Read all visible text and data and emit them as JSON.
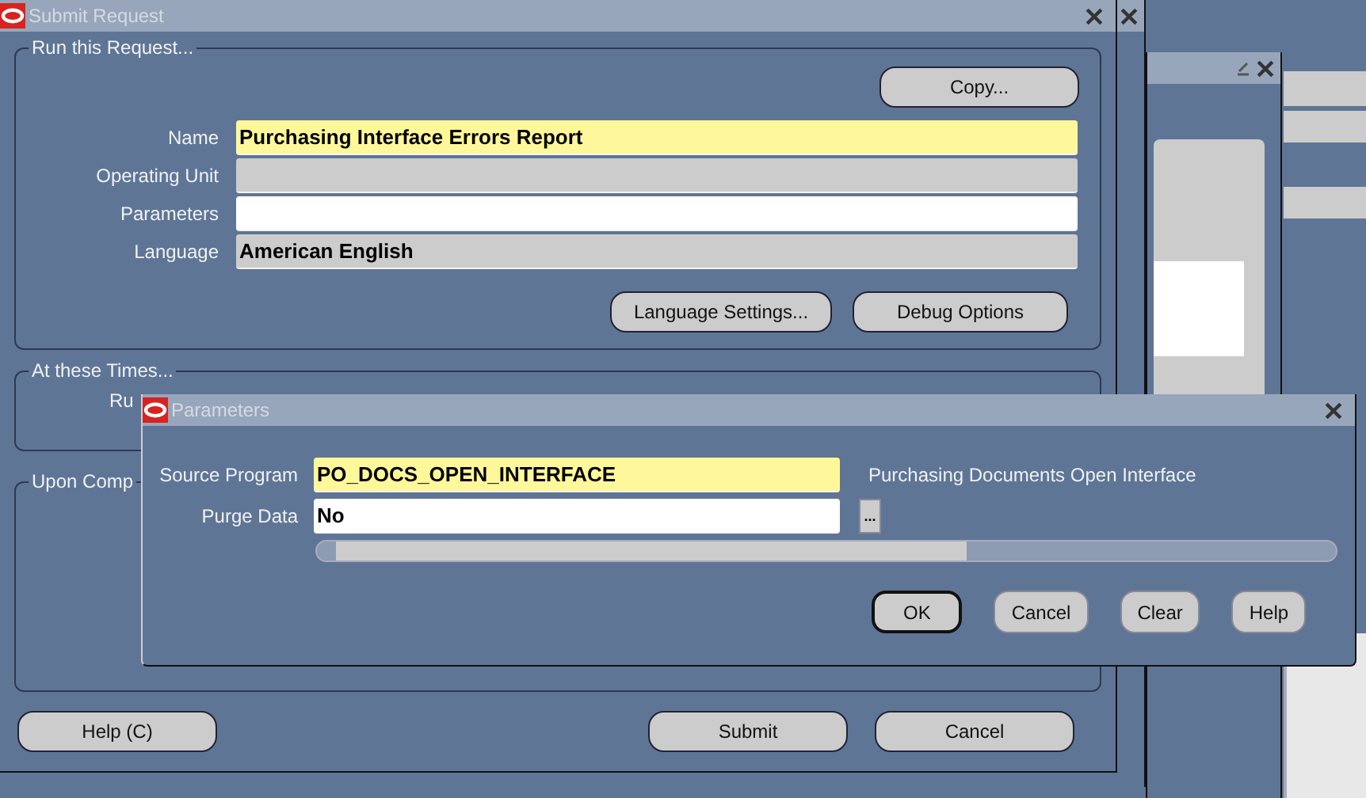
{
  "window": {
    "title": "Submit Request"
  },
  "run_request": {
    "title": "Run this Request...",
    "copy_button": "Copy...",
    "fields": [
      {
        "label": "Name",
        "value": "Purchasing Interface Errors Report",
        "kind": "required"
      },
      {
        "label": "Operating Unit",
        "kind": "readonly"
      },
      {
        "label": "Parameters",
        "kind": "editable"
      },
      {
        "label": "Language",
        "value": "American English",
        "kind": "readonly"
      }
    ],
    "buttons": [
      "Language Settings...",
      "Debug Options"
    ]
  },
  "schedule": {
    "title": "At these Times...",
    "label": "Ru"
  },
  "completion": {
    "title": "Upon Comp"
  },
  "buttons": [
    "Help (C)",
    "Submit",
    "Cancel"
  ],
  "parameters_dialog": {
    "title": "Parameters",
    "fields": [
      {
        "label": "Source Program",
        "value": "PO_DOCS_OPEN_INTERFACE",
        "kind": "required",
        "description": "Purchasing Documents Open Interface"
      },
      {
        "label": "Purge Data",
        "value": "No",
        "kind": "editable",
        "lov": true
      }
    ],
    "lov_button": "...",
    "buttons": [
      {
        "label": "OK",
        "focused": true
      },
      {
        "label": "Cancel",
        "focused": false
      },
      {
        "label": "Clear",
        "focused": false
      },
      {
        "label": "Help",
        "focused": false
      }
    ]
  }
}
